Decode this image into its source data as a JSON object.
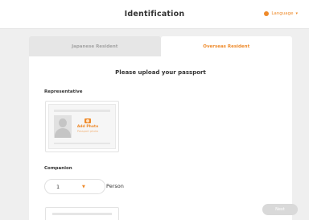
{
  "header": {
    "title": "Identification",
    "language_label": "Language",
    "language_icon": "globe-icon",
    "chevron_icon": "chevron-down-icon"
  },
  "tabs": [
    {
      "label": "Japanese Resident",
      "active": false
    },
    {
      "label": "Overseas Resident",
      "active": true
    }
  ],
  "main": {
    "heading": "Please upload your passport",
    "representative_label": "Representative",
    "passport_upload": {
      "title": "Add Photo",
      "subtitle": "Passport photo"
    },
    "companion_label": "Companion",
    "companion_count": "1",
    "companion_unit": "Person"
  },
  "footer": {
    "next_label": "Next"
  },
  "colors": {
    "accent": "#ee8a2a",
    "disabled_button": "#d9d9d9",
    "background": "#efefef"
  }
}
